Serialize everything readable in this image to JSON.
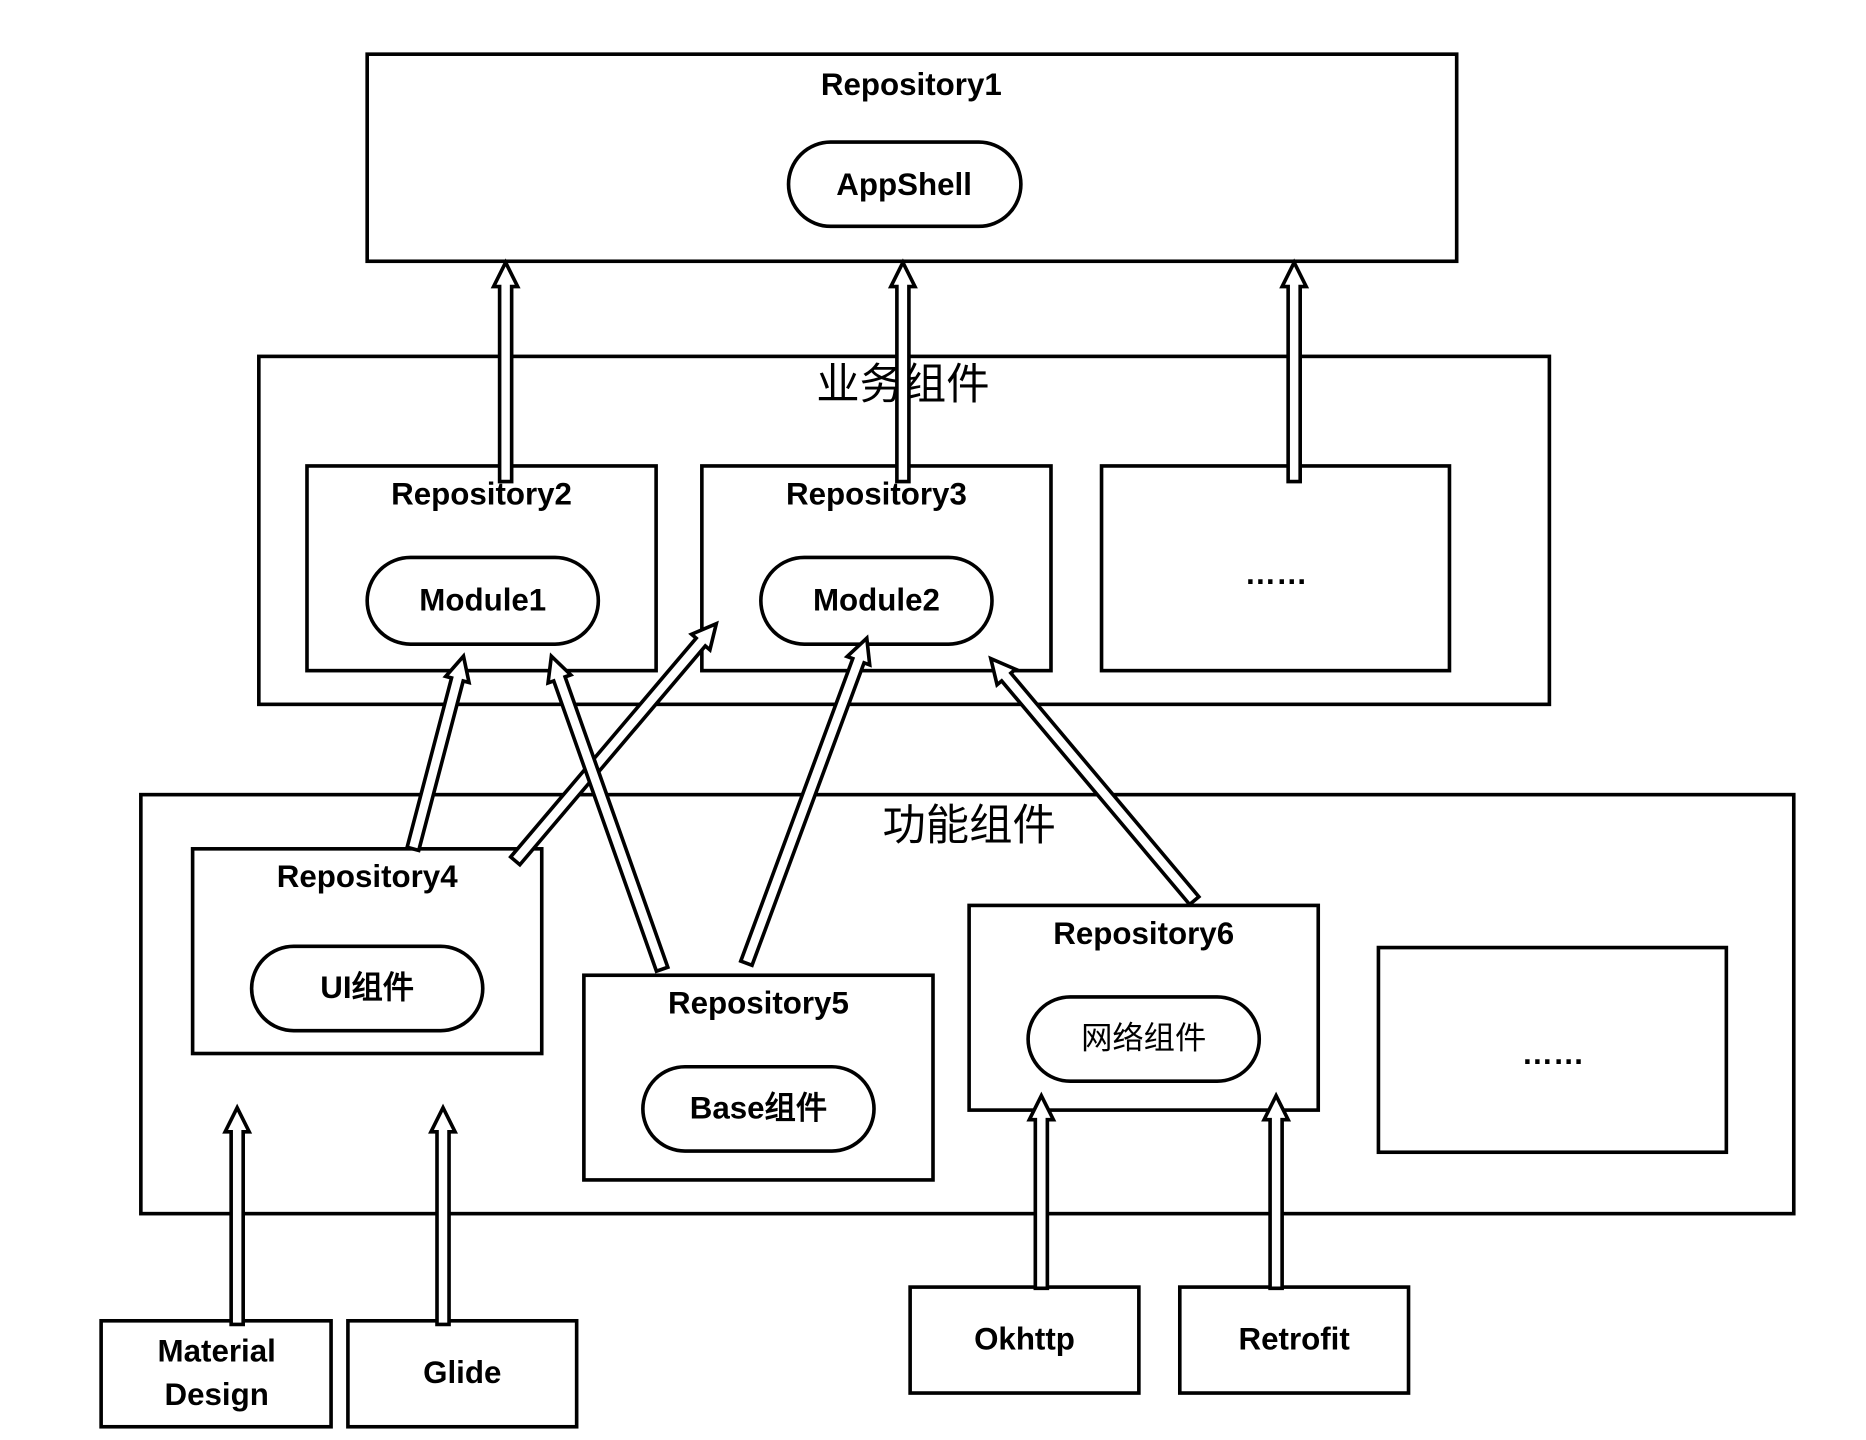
{
  "repository1": {
    "label": "Repository1",
    "module": "AppShell"
  },
  "business_group": {
    "title": "业务组件"
  },
  "repository2": {
    "label": "Repository2",
    "module": "Module1"
  },
  "repository3": {
    "label": "Repository3",
    "module": "Module2"
  },
  "business_more": {
    "label": "……"
  },
  "function_group": {
    "title": "功能组件"
  },
  "repository4": {
    "label": "Repository4",
    "module": "UI组件"
  },
  "repository5": {
    "label": "Repository5",
    "module": "Base组件"
  },
  "repository6": {
    "label": "Repository6",
    "module": "网络组件"
  },
  "function_more": {
    "label": "……"
  },
  "libraries": {
    "material_design": [
      "Material",
      "Design"
    ],
    "glide": "Glide",
    "okhttp": "Okhttp",
    "retrofit": "Retrofit"
  },
  "edges": [
    {
      "from": "Repository2",
      "to": "Repository1"
    },
    {
      "from": "Repository3",
      "to": "Repository1"
    },
    {
      "from": "……",
      "to": "Repository1"
    },
    {
      "from": "Repository4",
      "to": "Module1"
    },
    {
      "from": "Repository4",
      "to": "Repository3"
    },
    {
      "from": "Repository5",
      "to": "Module1"
    },
    {
      "from": "Repository5",
      "to": "Module2"
    },
    {
      "from": "Repository6",
      "to": "Repository3"
    },
    {
      "from": "Material Design",
      "to": "Repository4"
    },
    {
      "from": "Glide",
      "to": "Repository4"
    },
    {
      "from": "Okhttp",
      "to": "Repository6"
    },
    {
      "from": "Retrofit",
      "to": "Repository6"
    }
  ]
}
